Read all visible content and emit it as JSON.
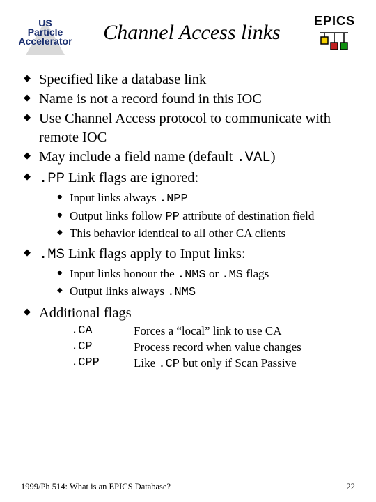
{
  "header": {
    "logo_left": {
      "l1": "US",
      "l2": "Particle",
      "l3": "Accelerator"
    },
    "title": "Channel Access links",
    "epics": "EPICS"
  },
  "bullets": {
    "b1": "Specified like a database link",
    "b2": "Name is not a record found in this IOC",
    "b3": "Use Channel Access protocol to communicate with remote IOC",
    "b4a": "May include a field name (default ",
    "b4b": ".VAL",
    "b4c": ")",
    "b5a": ".PP",
    "b5b": " Link flags are ignored:",
    "s5_1a": "Input links always ",
    "s5_1b": ".NPP",
    "s5_2a": "Output links follow ",
    "s5_2b": "PP",
    "s5_2c": " attribute of destination field",
    "s5_3": "This behavior identical to all other CA clients",
    "b6a": ".MS",
    "b6b": " Link flags apply to Input links:",
    "s6_1a": "Input links honour the ",
    "s6_1b": ".NMS",
    "s6_1c": " or ",
    "s6_1d": ".MS",
    "s6_1e": " flags",
    "s6_2a": "Output links always ",
    "s6_2b": ".NMS",
    "b7": "Additional flags",
    "f1k": ".CA",
    "f1d": "Forces a “local” link to use CA",
    "f2k": ".CP",
    "f2d": "Process record when value changes",
    "f3k": ".CPP",
    "f3da": "Like ",
    "f3db": ".CP",
    "f3dc": " but only if Scan Passive"
  },
  "footer": {
    "left": "1999/Ph 514: What is an EPICS Database?",
    "right": "22"
  }
}
